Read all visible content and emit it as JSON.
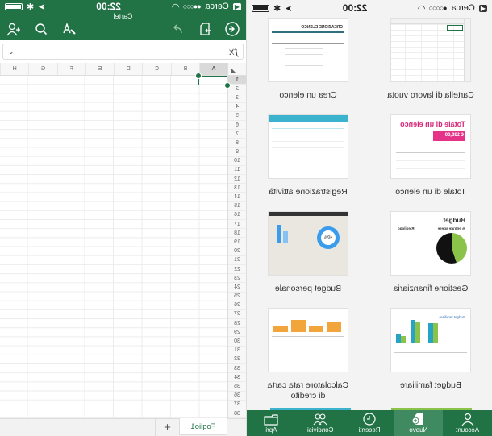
{
  "templates_screen": {
    "status_bar": {
      "carrier": "Cerca",
      "time": "22:00"
    },
    "templates": [
      {
        "label": "Cartella di lavoro vuota"
      },
      {
        "label": "Crea un elenco",
        "thumb_title": "CREAZIONE ELENCO"
      },
      {
        "label": "Totale di un elenco",
        "thumb_title": "Totale di un elenco",
        "thumb_value": "€ 139,00"
      },
      {
        "label": "Registrazione attività"
      },
      {
        "label": "Gestione finanziaria",
        "thumb_title": "Budget",
        "thumb_subtitle": "% entrate spese",
        "thumb_summary": "Riepilogo"
      },
      {
        "label": "Budget personale",
        "thumb_value": "40%"
      },
      {
        "label": "Budget familiare",
        "thumb_title": "Budget familiare"
      },
      {
        "label": "Calcolatore rata carta di credito"
      }
    ],
    "tab_bar": [
      {
        "label": "Account",
        "icon": "person-icon",
        "active": false
      },
      {
        "label": "Nuovo",
        "icon": "new-file-icon",
        "active": true
      },
      {
        "label": "Recenti",
        "icon": "clock-icon",
        "active": false
      },
      {
        "label": "Condivisi",
        "icon": "people-icon",
        "active": false
      },
      {
        "label": "Apri",
        "icon": "folder-icon",
        "active": false
      }
    ]
  },
  "sheet_screen": {
    "status_bar": {
      "carrier": "Cerca",
      "time": "22:00"
    },
    "document_title": "Cartel",
    "toolbar": {
      "back_icon": "back-arrow-icon",
      "file_icon": "file-export-icon",
      "redo_icon": "redo-icon",
      "format_icon": "text-format-icon",
      "search_icon": "search-icon",
      "share_icon": "add-person-icon"
    },
    "formula_bar": {
      "fx_label": "fx",
      "value": ""
    },
    "columns": [
      "A",
      "B",
      "C",
      "D",
      "E",
      "F",
      "G",
      "H"
    ],
    "rows": [
      "1",
      "2",
      "3",
      "4",
      "5",
      "6",
      "7",
      "8",
      "9",
      "10",
      "11",
      "12",
      "13",
      "14",
      "15",
      "16",
      "17",
      "18",
      "19",
      "20",
      "21",
      "22",
      "23",
      "24",
      "25",
      "26",
      "27",
      "28",
      "29",
      "30",
      "31",
      "32",
      "33",
      "34",
      "35",
      "36",
      "37",
      "38"
    ],
    "selected_cell": "A1",
    "sheet_tabs": [
      {
        "label": "Foglio1",
        "active": true
      }
    ],
    "add_sheet_label": "+"
  }
}
